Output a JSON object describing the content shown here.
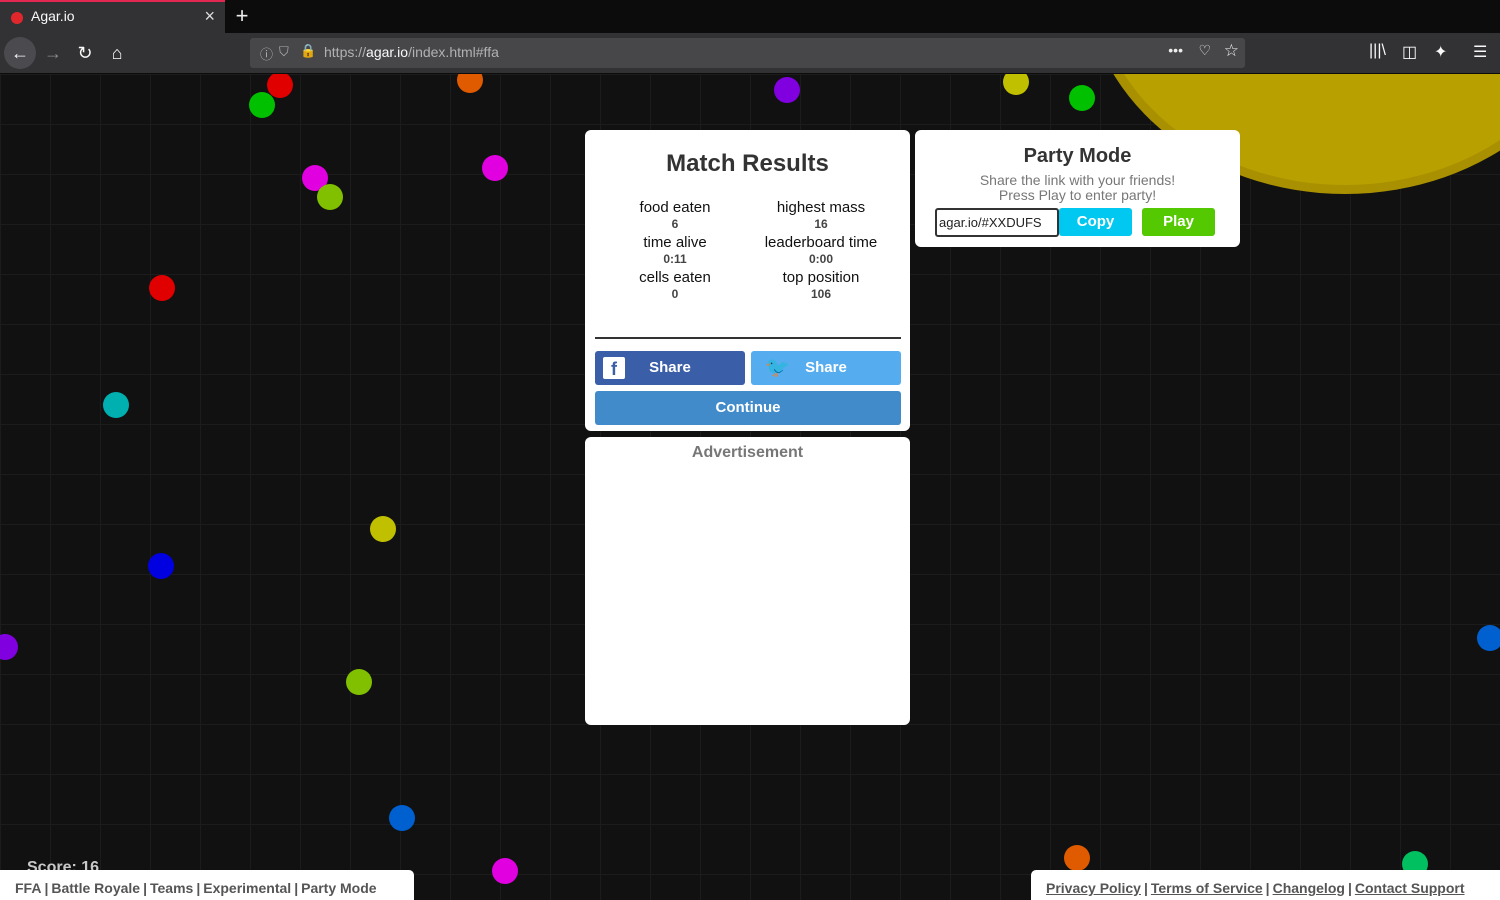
{
  "browser": {
    "tab_title": "Agar.io",
    "url_prefix": "https://",
    "url_domain": "agar.io",
    "url_path": "/index.html#ffa"
  },
  "game": {
    "score": "Score: 16",
    "food_colors": [
      "#e00000",
      "#00c000",
      "#e05a00",
      "#8000e0",
      "#c0c000",
      "#e000e0",
      "#00b0b0",
      "#0000e0",
      "#80c000",
      "#0060d0",
      "#00c060"
    ]
  },
  "results": {
    "title": "Match Results",
    "stats": [
      {
        "label": "food eaten",
        "value": "6"
      },
      {
        "label": "highest mass",
        "value": "16"
      },
      {
        "label": "time alive",
        "value": "0:11"
      },
      {
        "label": "leaderboard time",
        "value": "0:00"
      },
      {
        "label": "cells eaten",
        "value": "0"
      },
      {
        "label": "top position",
        "value": "106"
      }
    ],
    "facebook_share": "Share",
    "twitter_share": "Share",
    "continue_label": "Continue"
  },
  "ad": {
    "title": "Advertisement"
  },
  "party": {
    "title": "Party Mode",
    "line1": "Share the link with your friends!",
    "line2": "Press Play to enter party!",
    "link_value": "agar.io/#XXDUFS",
    "copy_label": "Copy",
    "play_label": "Play"
  },
  "footer": {
    "modes": [
      "FFA",
      "Battle Royale",
      "Teams",
      "Experimental",
      "Party Mode"
    ],
    "links": [
      "Privacy Policy",
      "Terms of Service",
      "Changelog",
      "Contact Support"
    ]
  }
}
